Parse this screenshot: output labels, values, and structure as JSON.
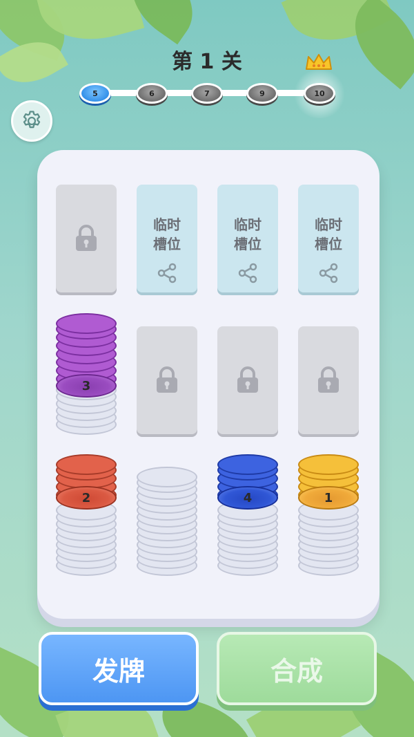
{
  "header": {
    "title": "第 1 关",
    "levels": [
      "5",
      "6",
      "7",
      "9",
      "10"
    ],
    "current_level": "5",
    "goal_level": "10"
  },
  "board": {
    "temp_slot_label_line1": "临时",
    "temp_slot_label_line2": "槽位",
    "stacks": [
      {
        "label": "3",
        "color": "purple"
      },
      {
        "label": "2",
        "color": "red"
      },
      {
        "label": "4",
        "color": "blue"
      },
      {
        "label": "1",
        "color": "yellow"
      }
    ]
  },
  "buttons": {
    "deal_label": "发牌",
    "merge_label": "合成"
  },
  "colors": {
    "purple": "#b05bd2",
    "red": "#e2624b",
    "blue": "#3d63e0",
    "yellow": "#f5c03a",
    "deal_button": "#4d96f3",
    "merge_button": "#9edb9b"
  },
  "icons": [
    "gear-icon",
    "crown-icon",
    "lock-icon",
    "share-icon"
  ]
}
